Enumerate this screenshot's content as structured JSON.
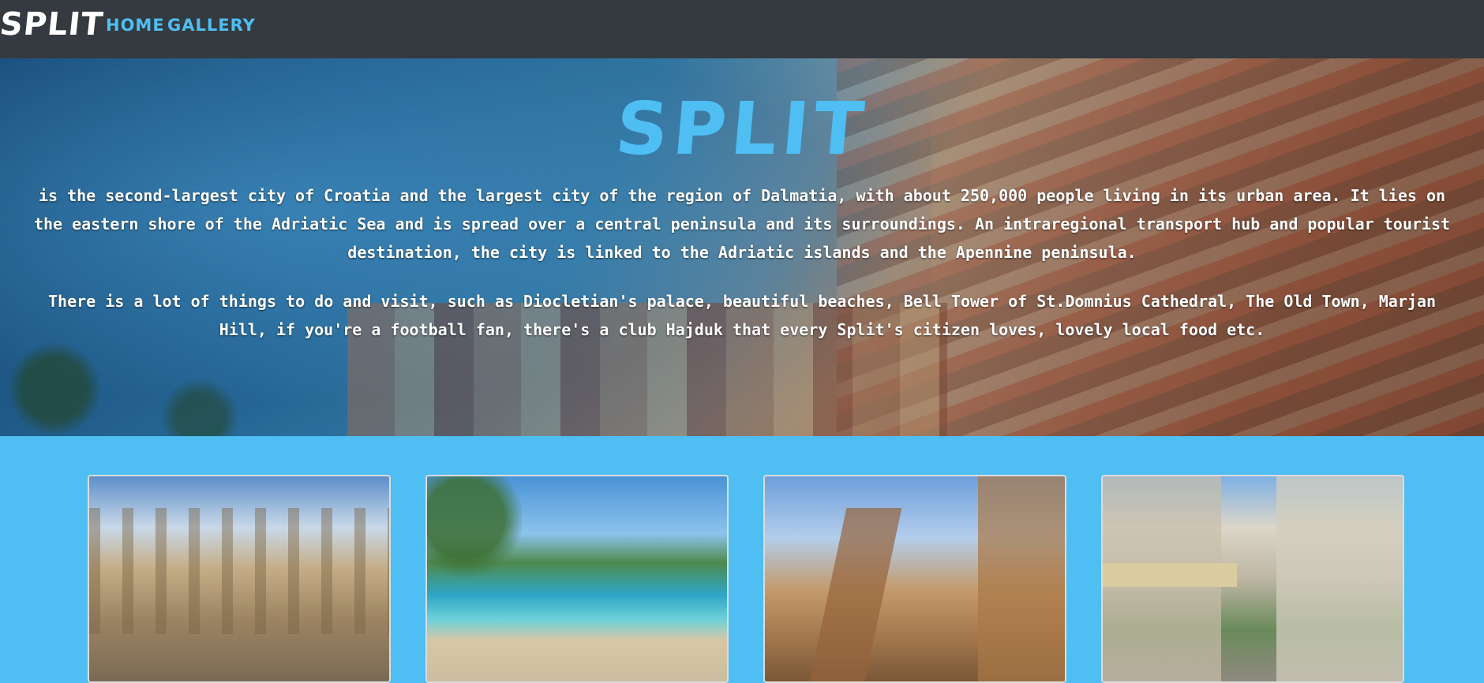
{
  "navbar": {
    "brand": "SPLIT",
    "links": [
      {
        "label": "HOME"
      },
      {
        "label": "GALLERY"
      }
    ]
  },
  "hero": {
    "title": "SPLIT",
    "paragraphs": [
      "is the second-largest city of Croatia and the largest city of the region of Dalmatia, with about 250,000 people living in its urban area. It lies on the eastern shore of the Adriatic Sea and is spread over a central peninsula and its surroundings. An intraregional transport hub and popular tourist destination, the city is linked to the Adriatic islands and the Apennine peninsula.",
      "There is a lot of things to do and visit, such as Diocletian's palace, beautiful beaches, Bell Tower of St.Domnius Cathedral, The Old Town, Marjan Hill, if you're a football fan, there's a club Hajduk that every Split's citizen loves, lovely local food etc."
    ]
  },
  "colors": {
    "navbar_bg": "#343a40",
    "accent": "#4fbef2",
    "page_bg": "#4fbef2"
  }
}
